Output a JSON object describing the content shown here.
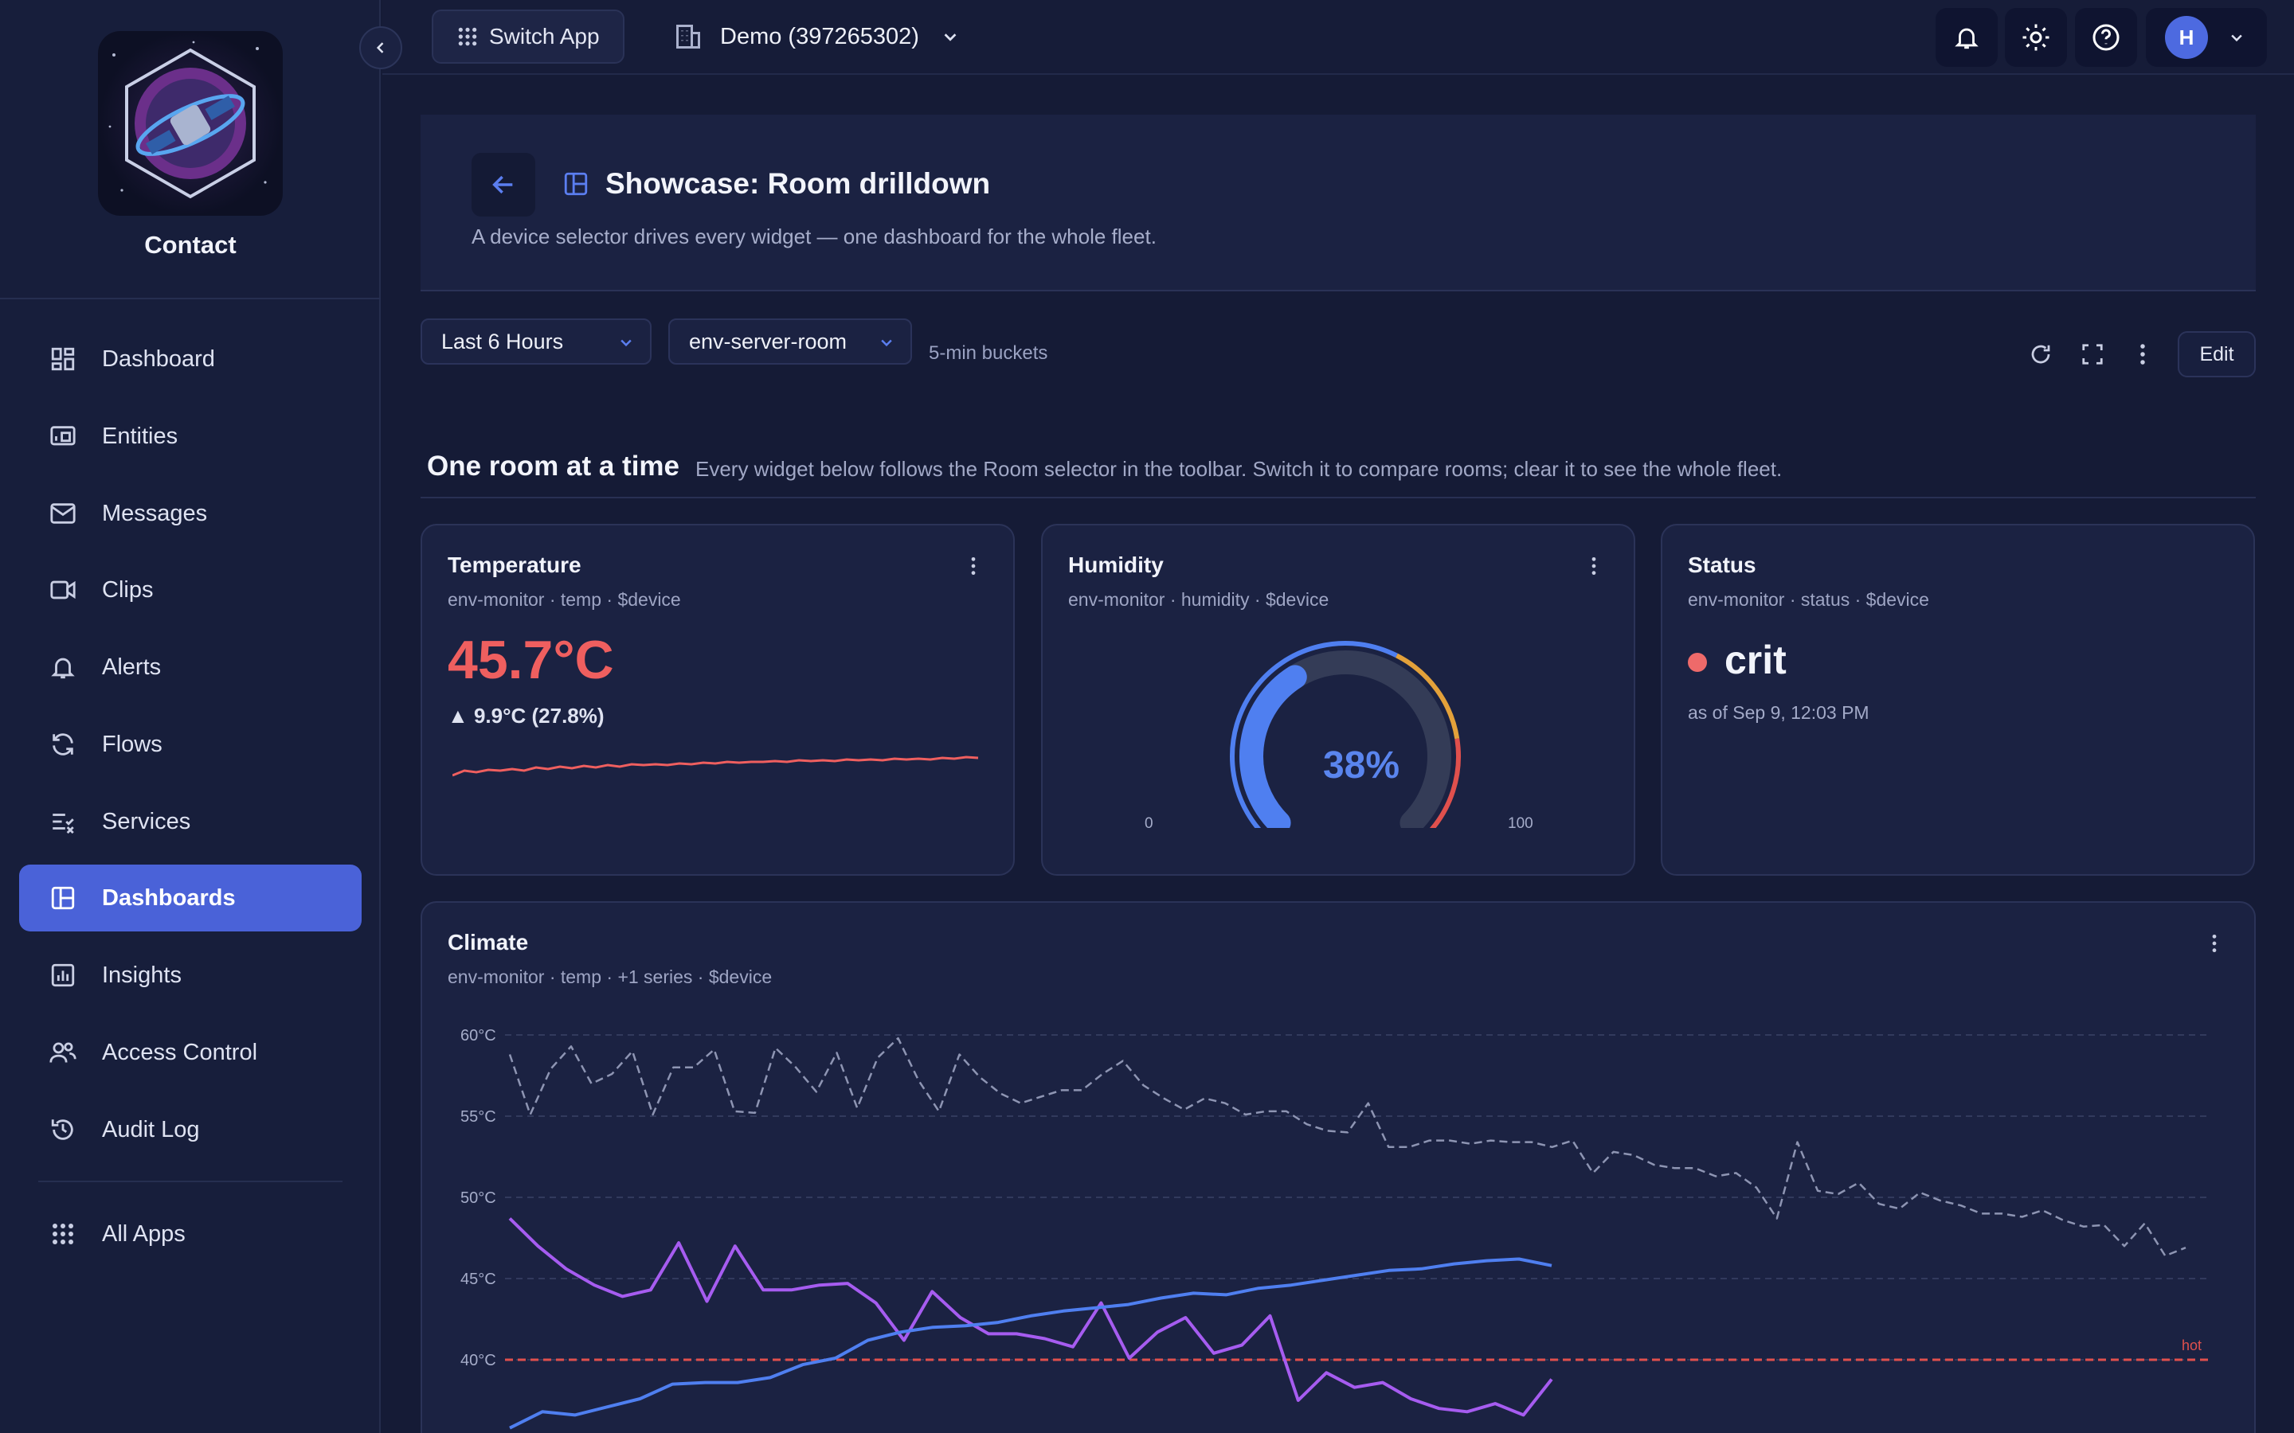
{
  "sidebar": {
    "brand_name": "Contact",
    "items": [
      {
        "label": "Dashboard",
        "icon": "dashboard-icon"
      },
      {
        "label": "Entities",
        "icon": "entities-icon"
      },
      {
        "label": "Messages",
        "icon": "mail-icon"
      },
      {
        "label": "Clips",
        "icon": "video-icon"
      },
      {
        "label": "Alerts",
        "icon": "bell-icon"
      },
      {
        "label": "Flows",
        "icon": "refresh-icon"
      },
      {
        "label": "Services",
        "icon": "services-icon"
      },
      {
        "label": "Dashboards",
        "icon": "layout-icon",
        "active": true
      },
      {
        "label": "Insights",
        "icon": "chart-icon"
      },
      {
        "label": "Access Control",
        "icon": "users-icon"
      },
      {
        "label": "Audit Log",
        "icon": "history-icon"
      }
    ],
    "all_apps": "All Apps"
  },
  "topbar": {
    "switch_app": "Switch App",
    "org": "Demo (397265302)",
    "avatar_initial": "H"
  },
  "header": {
    "title": "Showcase: Room drilldown",
    "description": "A device selector drives every widget — one dashboard for the whole fleet."
  },
  "toolbar": {
    "time_range": "Last 6 Hours",
    "device": "env-server-room",
    "buckets": "5-min buckets",
    "edit_label": "Edit"
  },
  "section": {
    "title": "One room at a time",
    "description": "Every widget below follows the Room selector in the toolbar. Switch it to compare rooms; clear it to see the whole fleet."
  },
  "temperature_card": {
    "title": "Temperature",
    "subtitle": "env-monitor · temp · $device",
    "value": "45.7°C",
    "delta": "▲ 9.9°C (27.8%)"
  },
  "humidity_card": {
    "title": "Humidity",
    "subtitle": "env-monitor · humidity · $device",
    "value_text": "38%",
    "value": 38,
    "min": "0",
    "max": "100"
  },
  "status_card": {
    "title": "Status",
    "subtitle": "env-monitor · status · $device",
    "value": "crit",
    "as_of": "as of Sep 9, 12:03 PM"
  },
  "climate_card": {
    "title": "Climate",
    "subtitle": "env-monitor · temp · +1 series · $device"
  },
  "colors": {
    "accent": "#4a62d8",
    "temp": "#ef5f5f",
    "blue_series": "#4f7ff0",
    "purple_series": "#a65cf0",
    "dashed_series": "#8e95b3",
    "threshold": "#e0504d"
  },
  "chart_data": {
    "type": "line",
    "ylabel": "",
    "y_ticks": [
      "60°C",
      "55°C",
      "50°C",
      "45°C",
      "40°C"
    ],
    "ylim": [
      35,
      61
    ],
    "threshold": {
      "value": 40,
      "label": "hot"
    },
    "series": [
      {
        "style": "dashed",
        "values": [
          58.8,
          55.1,
          57.9,
          59.3,
          57.0,
          57.6,
          59.0,
          55.1,
          58.0,
          58.0,
          59.1,
          55.3,
          55.2,
          59.2,
          58.0,
          56.5,
          58.9,
          55.5,
          58.6,
          59.8,
          57.2,
          55.3,
          58.8,
          57.4,
          56.4,
          55.8,
          56.2,
          56.6,
          56.6,
          57.6,
          58.4,
          56.9,
          56.1,
          55.4,
          56.1,
          55.8,
          55.1,
          55.3,
          55.3,
          54.5,
          54.1,
          54.0,
          55.8,
          53.1,
          53.1,
          53.5,
          53.5,
          53.3,
          53.5,
          53.4,
          53.4,
          53.1,
          53.5,
          51.5,
          52.8,
          52.6,
          52.0,
          51.8,
          51.8,
          51.3,
          51.5,
          50.6,
          48.7,
          53.4,
          50.4,
          50.2,
          50.9,
          49.6,
          49.3,
          50.3,
          49.8,
          49.5,
          49.0,
          49.0,
          48.8,
          49.2,
          48.6,
          48.2,
          48.3,
          47.0,
          48.4,
          46.4,
          46.9
        ]
      },
      {
        "style": "solid-purple",
        "values": [
          48.7,
          47.0,
          45.6,
          44.6,
          43.9,
          44.3,
          47.2,
          43.6,
          47.0,
          44.3,
          44.3,
          44.6,
          44.7,
          43.5,
          41.2,
          44.2,
          42.6,
          41.6,
          41.6,
          41.3,
          40.8,
          43.5,
          40.1,
          41.7,
          42.6,
          40.4,
          40.9,
          42.7,
          37.5,
          39.2,
          38.3,
          38.6,
          37.6,
          37.0,
          36.8,
          37.3,
          36.6,
          38.8
        ]
      },
      {
        "style": "solid-blue",
        "values": [
          35.8,
          36.8,
          36.6,
          37.1,
          37.6,
          38.5,
          38.6,
          38.6,
          38.9,
          39.7,
          40.1,
          41.2,
          41.7,
          42.0,
          42.1,
          42.3,
          42.7,
          43.0,
          43.2,
          43.4,
          43.8,
          44.1,
          44.0,
          44.4,
          44.6,
          44.9,
          45.2,
          45.5,
          45.6,
          45.9,
          46.1,
          46.2,
          45.8
        ]
      }
    ]
  }
}
